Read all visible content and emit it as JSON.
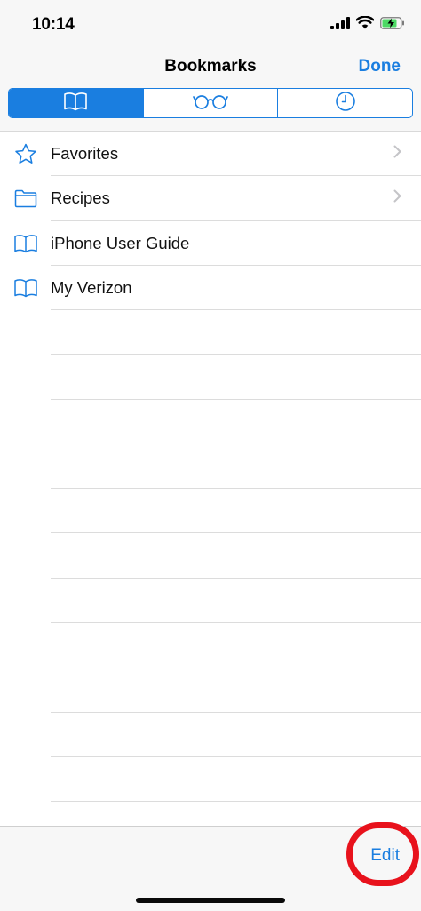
{
  "status_bar": {
    "time": "10:14"
  },
  "nav": {
    "title": "Bookmarks",
    "done_label": "Done"
  },
  "segments": [
    {
      "icon": "book-icon",
      "active": true
    },
    {
      "icon": "reading-glasses-icon",
      "active": false
    },
    {
      "icon": "clock-icon",
      "active": false
    }
  ],
  "list": {
    "items": [
      {
        "label": "Favorites",
        "icon": "star-icon",
        "chevron": true
      },
      {
        "label": "Recipes",
        "icon": "folder-icon",
        "chevron": true
      },
      {
        "label": "iPhone User Guide",
        "icon": "book-icon",
        "chevron": false
      },
      {
        "label": "My Verizon",
        "icon": "book-icon",
        "chevron": false
      }
    ]
  },
  "toolbar": {
    "edit_label": "Edit"
  },
  "colors": {
    "accent": "#1a7ee0",
    "highlight": "#e8121c",
    "battery": "#4cd964"
  }
}
